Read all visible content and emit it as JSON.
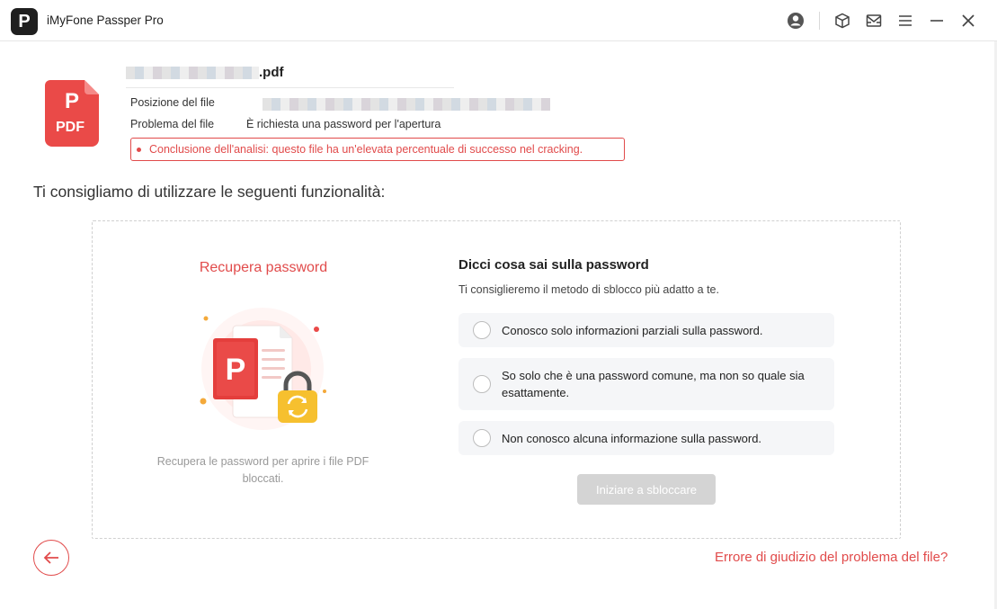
{
  "window": {
    "title": "iMyFone Passper Pro",
    "logo_letter": "P",
    "controls": [
      "account-icon",
      "package-icon",
      "mail-icon",
      "menu-icon",
      "minimize-icon",
      "close-icon"
    ]
  },
  "file": {
    "name_suffix": ".pdf",
    "location_label": "Posizione del file",
    "problem_label": "Problema del file",
    "problem_value": "È richiesta una password per l'apertura",
    "analysis": "Conclusione dell'analisi: questo file ha un'elevata percentuale di successo nel cracking.",
    "icon_text": "PDF"
  },
  "recommendation_heading": "Ti consigliamo di utilizzare le seguenti funzionalità:",
  "feature": {
    "title": "Recupera password",
    "description": "Recupera le password per aprire i file PDF bloccati."
  },
  "questionnaire": {
    "title": "Dicci cosa sai sulla password",
    "subtitle": "Ti consiglieremo il metodo di sblocco più adatto a te.",
    "options": [
      "Conosco solo informazioni parziali sulla password.",
      "So solo che è una password comune, ma non so quale sia esattamente.",
      "Non conosco alcuna informazione sulla password."
    ],
    "start_button": "Iniziare a sbloccare"
  },
  "footer": {
    "error_link": "Errore di giudizio del problema del file?"
  },
  "colors": {
    "accent": "#e14b4b",
    "disabled_button": "#d4d4d4",
    "option_bg": "#f5f6f8"
  }
}
